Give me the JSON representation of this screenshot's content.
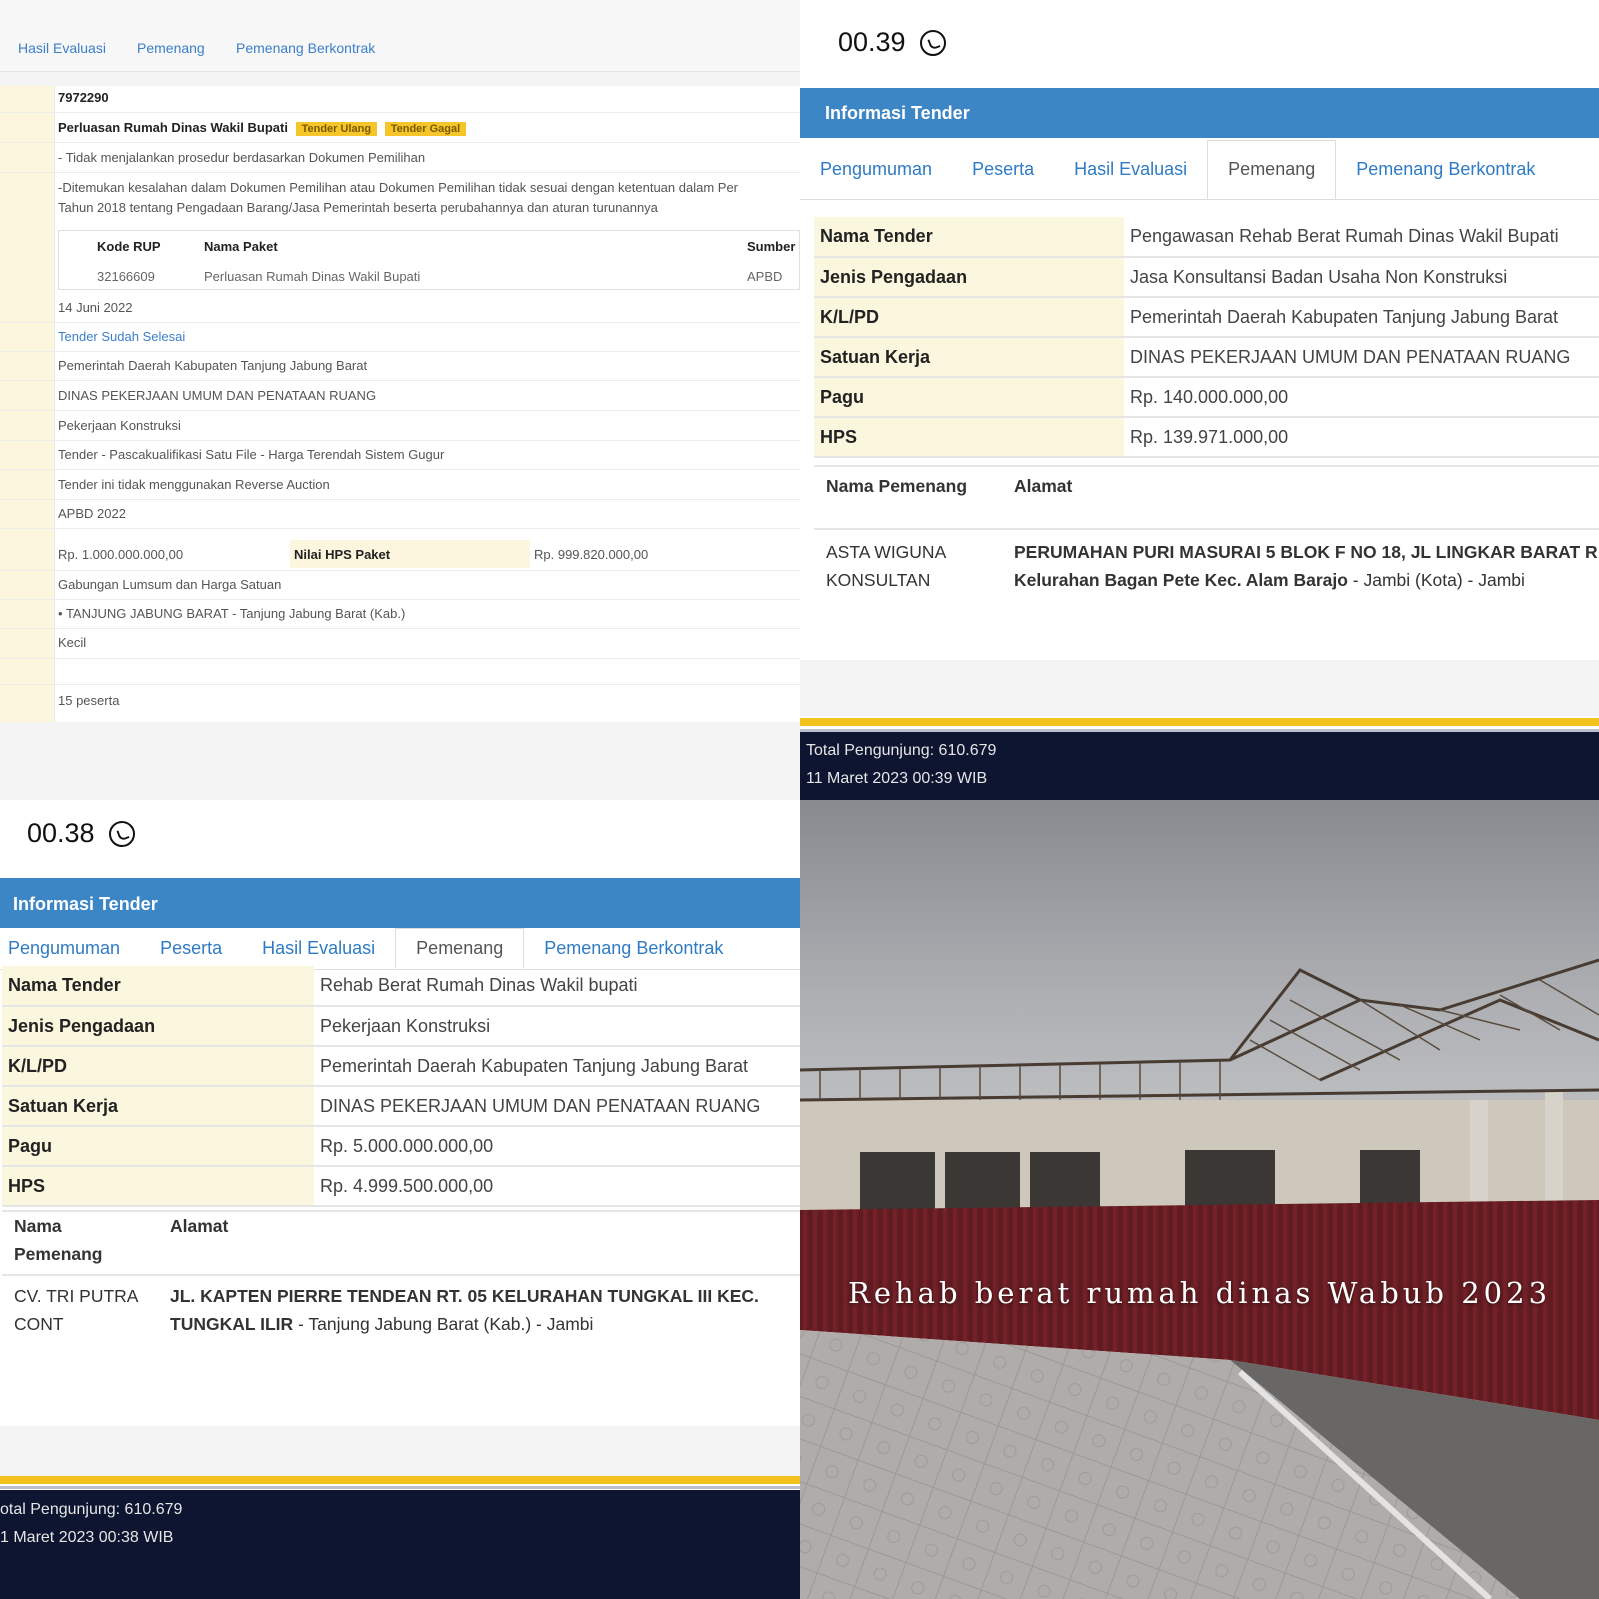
{
  "top_left": {
    "tabs": [
      "Hasil Evaluasi",
      "Pemenang",
      "Pemenang Berkontrak"
    ],
    "kode": "7972290",
    "nama_tender": "Perluasan Rumah Dinas Wakil Bupati",
    "badges": [
      "Tender Ulang",
      "Tender Gagal"
    ],
    "alasan_1": "- Tidak menjalankan prosedur berdasarkan Dokumen Pemilihan",
    "alasan_2a": "-Ditemukan kesalahan dalam Dokumen Pemilihan atau Dokumen Pemilihan tidak sesuai dengan ketentuan dalam Per",
    "alasan_2b": "Tahun 2018 tentang Pengadaan Barang/Jasa Pemerintah beserta perubahannya dan aturan turunannya",
    "rup_headers": [
      "Kode RUP",
      "Nama Paket",
      "Sumber"
    ],
    "rup_row": [
      "32166609",
      "Perluasan Rumah Dinas Wakil Bupati",
      "APBD"
    ],
    "tanggal": "14 Juni 2022",
    "tahap": "Tender Sudah Selesai",
    "klpd": "Pemerintah Daerah Kabupaten Tanjung Jabung Barat",
    "satker": "DINAS PEKERJAAN UMUM DAN PENATAAN RUANG",
    "jenis": "Pekerjaan Konstruksi",
    "metode": "Tender - Pascakualifikasi Satu File - Harga Terendah Sistem Gugur",
    "reverse": "Tender ini tidak menggunakan Reverse Auction",
    "anggaran": "APBD 2022",
    "pagu": "Rp. 1.000.000.000,00",
    "hps_label": "Nilai HPS Paket",
    "hps": "Rp. 999.820.000,00",
    "kontrak": "Gabungan Lumsum dan Harga Satuan",
    "lokasi": "TANJUNG JABUNG BARAT - Tanjung Jabung Barat (Kab.)",
    "kualifikasi": "Kecil",
    "peserta": "15 peserta"
  },
  "top_right": {
    "time": "00.39",
    "header": "Informasi Tender",
    "tabs": [
      "Pengumuman",
      "Peserta",
      "Hasil Evaluasi",
      "Pemenang",
      "Pemenang Berkontrak"
    ],
    "active_tab": "Pemenang",
    "rows": [
      {
        "k": "Nama Tender",
        "v": "Pengawasan Rehab Berat Rumah Dinas Wakil Bupati"
      },
      {
        "k": "Jenis Pengadaan",
        "v": "Jasa Konsultansi Badan Usaha Non Konstruksi"
      },
      {
        "k": "K/L/PD",
        "v": "Pemerintah Daerah Kabupaten Tanjung Jabung Barat"
      },
      {
        "k": "Satuan Kerja",
        "v": "DINAS PEKERJAAN UMUM DAN PENATAAN RUANG"
      },
      {
        "k": "Pagu",
        "v": "Rp. 140.000.000,00"
      },
      {
        "k": "HPS",
        "v": "Rp. 139.971.000,00"
      }
    ],
    "winner_headers": [
      "Nama Pemenang",
      "Alamat"
    ],
    "winner_name_1": "ASTA WIGUNA",
    "winner_name_2": "KONSULTAN",
    "winner_addr_1": "PERUMAHAN PURI MASURAI 5 BLOK F NO 18, JL LINGKAR BARAT R",
    "winner_addr_2_bold": "Kelurahan Bagan Pete Kec. Alam Barajo",
    "winner_addr_2_rest": " - Jambi (Kota) - Jambi",
    "footer_visitors": "Total Pengunjung: 610.679",
    "footer_date": "11 Maret 2023 00:39 WIB"
  },
  "bottom_left": {
    "time": "00.38",
    "header": "Informasi Tender",
    "tabs": [
      "Pengumuman",
      "Peserta",
      "Hasil Evaluasi",
      "Pemenang",
      "Pemenang Berkontrak"
    ],
    "active_tab": "Pemenang",
    "rows": [
      {
        "k": "Nama Tender",
        "v": "Rehab Berat Rumah Dinas Wakil bupati"
      },
      {
        "k": "Jenis Pengadaan",
        "v": "Pekerjaan Konstruksi"
      },
      {
        "k": "K/L/PD",
        "v": "Pemerintah Daerah Kabupaten Tanjung Jabung Barat"
      },
      {
        "k": "Satuan Kerja",
        "v": "DINAS PEKERJAAN UMUM DAN PENATAAN RUANG"
      },
      {
        "k": "Pagu",
        "v": "Rp. 5.000.000.000,00"
      },
      {
        "k": "HPS",
        "v": "Rp. 4.999.500.000,00"
      }
    ],
    "winner_header_name_1": "Nama",
    "winner_header_name_2": "Pemenang",
    "winner_header_addr": "Alamat",
    "winner_name_1": "CV. TRI PUTRA",
    "winner_name_2": "CONT",
    "winner_addr_1": "JL. KAPTEN PIERRE TENDEAN RT. 05 KELURAHAN TUNGKAL III KEC.",
    "winner_addr_2_bold": "TUNGKAL ILIR",
    "winner_addr_2_rest": " - Tanjung Jabung Barat (Kab.) - Jambi",
    "footer_visitors": "otal Pengunjung: 610.679",
    "footer_date": "1 Maret 2023 00:38 WIB"
  },
  "photo": {
    "caption": "Rehab berat rumah dinas Wabub 2023"
  },
  "colors": {
    "header_blue": "#3d86c6",
    "link_blue": "#2f7bc3",
    "label_bg": "#fbf6de",
    "footer_navy": "#0d1530",
    "footer_gold": "#f2c11c",
    "badge_yellow": "#f6c52a",
    "fence_red": "#7a2228"
  },
  "icons": [
    "whatsapp-icon"
  ]
}
